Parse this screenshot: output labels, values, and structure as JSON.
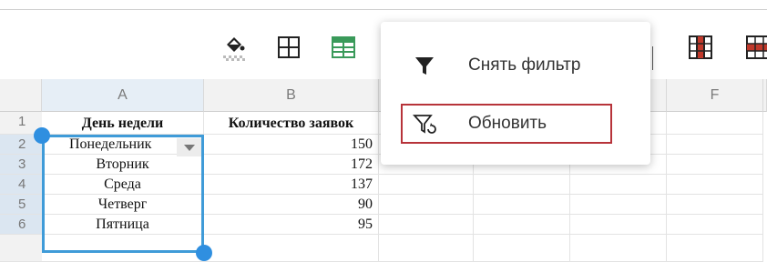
{
  "toolbar": {
    "icons": [
      "fill-color-icon",
      "borders-icon",
      "table-style-icon",
      "freeze-columns-icon",
      "column-icon"
    ]
  },
  "grid": {
    "columns": [
      {
        "id": "A",
        "label": "A"
      },
      {
        "id": "B",
        "label": "B"
      },
      {
        "id": "C",
        "label": ""
      },
      {
        "id": "D",
        "label": ""
      },
      {
        "id": "E",
        "label": ""
      },
      {
        "id": "F",
        "label": "F"
      },
      {
        "id": "G",
        "label": ""
      }
    ],
    "row_numbers": [
      "1",
      "2",
      "3",
      "4",
      "5",
      "6"
    ],
    "header_row": [
      "День недели",
      "Количество заявок"
    ],
    "rows": [
      {
        "day": "Понедельник",
        "count": "150"
      },
      {
        "day": "Вторник",
        "count": "172"
      },
      {
        "day": "Среда",
        "count": "137"
      },
      {
        "day": "Четверг",
        "count": "90"
      },
      {
        "day": "Пятница",
        "count": "95"
      }
    ]
  },
  "menu": {
    "items": [
      {
        "label": "Снять фильтр",
        "icon": "filter-icon"
      },
      {
        "label": "Обновить",
        "icon": "filter-refresh-icon"
      }
    ],
    "highlight_color": "#b7333a"
  },
  "colors": {
    "selection": "#3f9bd8",
    "handle": "#2f8fe0",
    "header_bg": "#f2f2f2"
  }
}
